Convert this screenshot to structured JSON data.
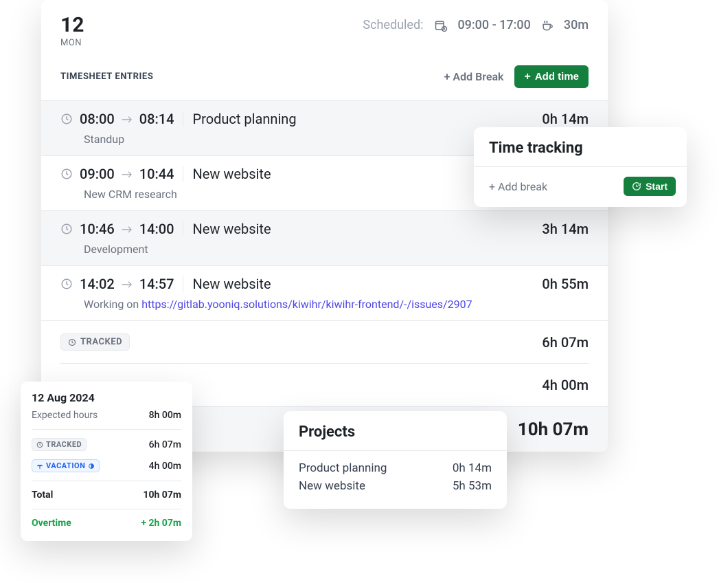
{
  "header": {
    "day_number": "12",
    "day_of_week": "MON",
    "scheduled_label": "Scheduled:",
    "schedule_time": "09:00 - 17:00",
    "break_duration": "30m"
  },
  "section_title": "TIMESHEET ENTRIES",
  "actions": {
    "add_break": "+ Add Break",
    "add_time": "Add time"
  },
  "entries": [
    {
      "start": "08:00",
      "end": "08:14",
      "project": "Product planning",
      "duration": "0h 14m",
      "sub": "Standup",
      "alt": true
    },
    {
      "start": "09:00",
      "end": "10:44",
      "project": "New website",
      "duration": "",
      "sub": "New CRM research",
      "alt": false
    },
    {
      "start": "10:46",
      "end": "14:00",
      "project": "New website",
      "duration": "3h 14m",
      "sub": "Development",
      "alt": true
    },
    {
      "start": "14:02",
      "end": "14:57",
      "project": "New website",
      "duration": "0h 55m",
      "sub_prefix": "Working on ",
      "sub_link": "https://gitlab.yooniq.solutions/kiwihr/kiwihr-frontend/-/issues/2907",
      "alt": false
    }
  ],
  "summary": {
    "tracked_label": "TRACKED",
    "tracked_value": "6h 07m",
    "row2_value": "4h 00m",
    "total_value": "10h 07m"
  },
  "date_card": {
    "title": "12 Aug 2024",
    "expected_label": "Expected hours",
    "expected_value": "8h 00m",
    "tracked_label": "TRACKED",
    "tracked_value": "6h 07m",
    "vacation_label": "VACATION",
    "vacation_value": "4h 00m",
    "total_label": "Total",
    "total_value": "10h 07m",
    "overtime_label": "Overtime",
    "overtime_value": "+ 2h 07m"
  },
  "projects_card": {
    "title": "Projects",
    "rows": [
      {
        "name": "Product planning",
        "value": "0h 14m"
      },
      {
        "name": "New website",
        "value": "5h 53m"
      }
    ]
  },
  "tt_card": {
    "title": "Time tracking",
    "add_break": "+ Add break",
    "start": "Start"
  }
}
